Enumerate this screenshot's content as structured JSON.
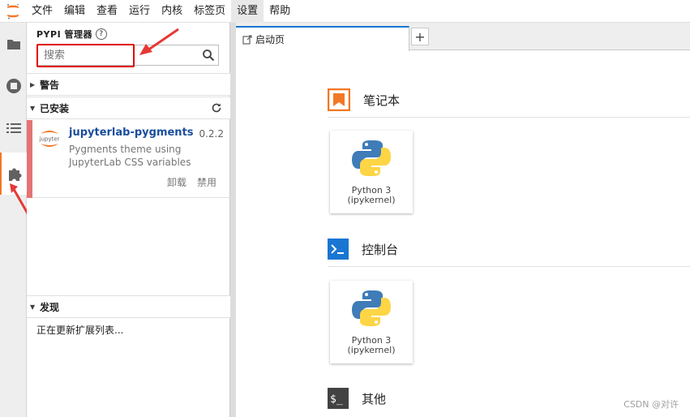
{
  "menubar": {
    "items": [
      "文件",
      "编辑",
      "查看",
      "运行",
      "内核",
      "标签页",
      "设置",
      "帮助"
    ],
    "active_index": 6
  },
  "sidebar": {
    "tabs": [
      "folder-icon",
      "running-icon",
      "toc-icon",
      "extension-icon"
    ],
    "active": "extension-icon"
  },
  "ext_manager": {
    "title": "PYPI 管理器",
    "help": "?",
    "search_placeholder": "搜索",
    "warnings_label": "警告",
    "installed_label": "已安装",
    "installed": [
      {
        "name": "jupyterlab-pygments",
        "version": "0.2.2",
        "description": "Pygments theme using JupyterLab CSS variables",
        "uninstall": "卸载",
        "disable": "禁用"
      }
    ],
    "discover_label": "发现",
    "discover_status": "正在更新扩展列表..."
  },
  "main": {
    "tab_label": "启动页",
    "add_tab": "+",
    "sections": [
      {
        "title": "笔记本",
        "card": {
          "line1": "Python 3",
          "line2": "(ipykernel)"
        }
      },
      {
        "title": "控制台",
        "card": {
          "line1": "Python 3",
          "line2": "(ipykernel)"
        }
      },
      {
        "title": "其他"
      }
    ]
  },
  "watermark": "CSDN @对许",
  "colors": {
    "accent": "#f37726",
    "tab_top": "#1976d2",
    "highlight": "#e00000",
    "stripe": "#e57373"
  }
}
